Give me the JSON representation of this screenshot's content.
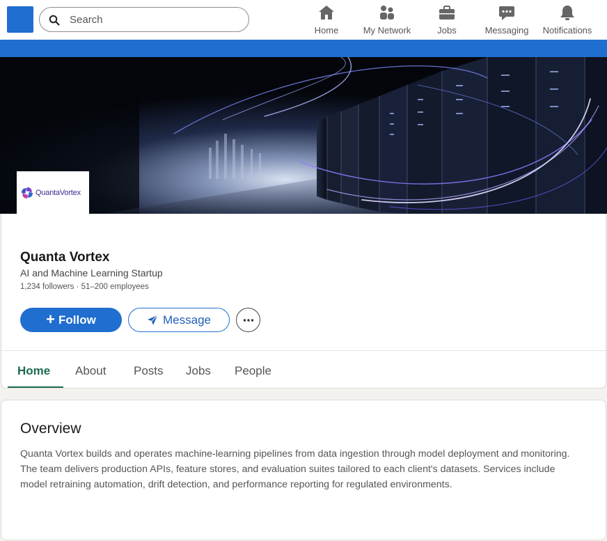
{
  "nav": {
    "search_placeholder": "Search",
    "items": [
      {
        "label": "Home",
        "icon": "home-icon"
      },
      {
        "label": "My Network",
        "icon": "network-icon"
      },
      {
        "label": "Jobs",
        "icon": "briefcase-icon"
      },
      {
        "label": "Messaging",
        "icon": "messaging-icon"
      },
      {
        "label": "Notifications",
        "icon": "bell-icon"
      }
    ]
  },
  "company": {
    "logo_text": "QuantaVortex",
    "name": "Quanta Vortex",
    "tagline": "AI and Machine Learning Startup",
    "meta": "1,234 followers · 51–200 employees"
  },
  "actions": {
    "follow_label": "Follow",
    "message_label": "Message"
  },
  "tabs": [
    {
      "label": "Home",
      "active": true
    },
    {
      "label": "About",
      "active": false
    },
    {
      "label": "Posts",
      "active": false
    },
    {
      "label": "Jobs",
      "active": false
    },
    {
      "label": "People",
      "active": false
    }
  ],
  "overview": {
    "title": "Overview",
    "text": "Quanta Vortex builds and operates machine-learning pipelines from data ingestion through model deployment and monitoring. The team delivers production APIs, feature stores, and evaluation suites tailored to each client's datasets. Services include model retraining automation, drift detection, and performance reporting for regulated environments."
  },
  "colors": {
    "brand_blue": "#1f6ed0",
    "active_tab_green": "#1b6b4e"
  }
}
